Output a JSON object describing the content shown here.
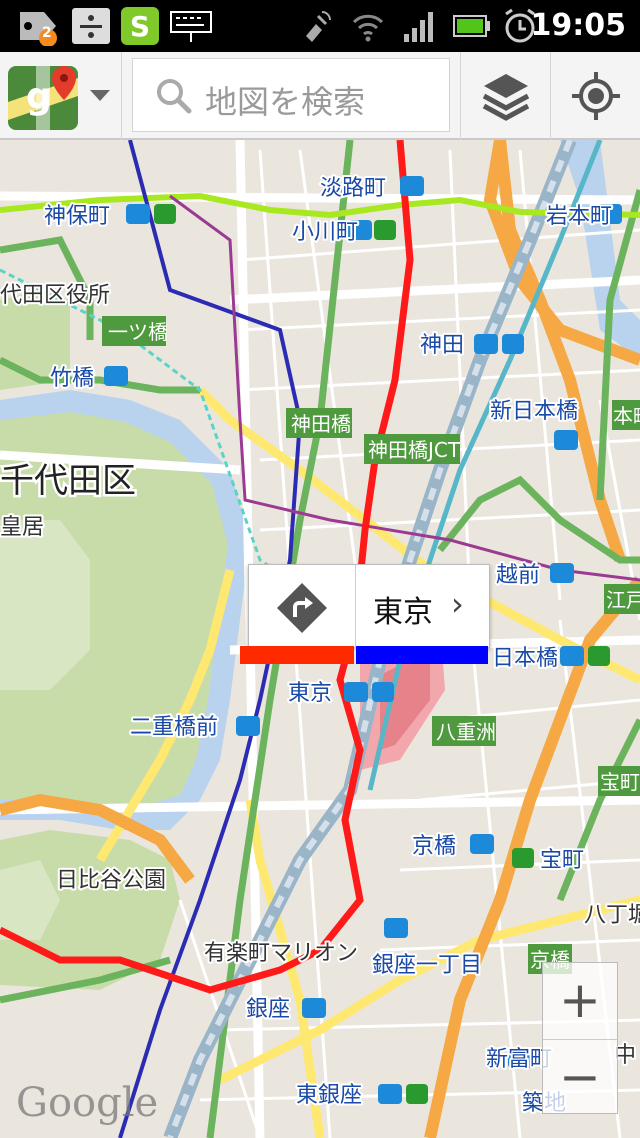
{
  "status_bar": {
    "notification_count": "2",
    "time": "19:05"
  },
  "toolbar": {
    "search_placeholder": "地図を検索"
  },
  "map": {
    "ward_label": "千代田区",
    "labels": {
      "awajicho": "淡路町",
      "jimbocho": "神保町",
      "ogawamachi": "小川町",
      "iwamotocho": "岩本町",
      "ward_office": "代田区役所",
      "hitotsubashi": "一ツ橋",
      "kanda": "神田",
      "takebashi": "竹橋",
      "kandabashi": "神田橋",
      "shinnihonbashi": "新日本橋",
      "kandabashi_jct": "神田橋JCT",
      "kokyo": "皇居",
      "mitsukoshimae": "越前",
      "nihonbashi": "日本橋",
      "edo": "江戸",
      "tokyo": "東京",
      "nijubashimae": "二重橋前",
      "yaesu": "八重洲",
      "kyobashi": "京橋",
      "takaracho": "宝町",
      "hibiya_park": "日比谷公園",
      "hatchobori": "八丁堀",
      "yurakucho_marion": "有楽町マリオン",
      "ginza_itchome": "銀座一丁目",
      "ginza": "銀座",
      "shintomicho": "新富町",
      "higashiginza": "東銀座",
      "tsukiji": "築地",
      "kyobashi_green": "京橋",
      "honcho": "本町",
      "takaracho_green": "宝町",
      "naka": "中"
    }
  },
  "callout": {
    "title": "東京"
  },
  "zoom": {
    "in_label": "+",
    "out_label": "−"
  },
  "attribution": "Google"
}
